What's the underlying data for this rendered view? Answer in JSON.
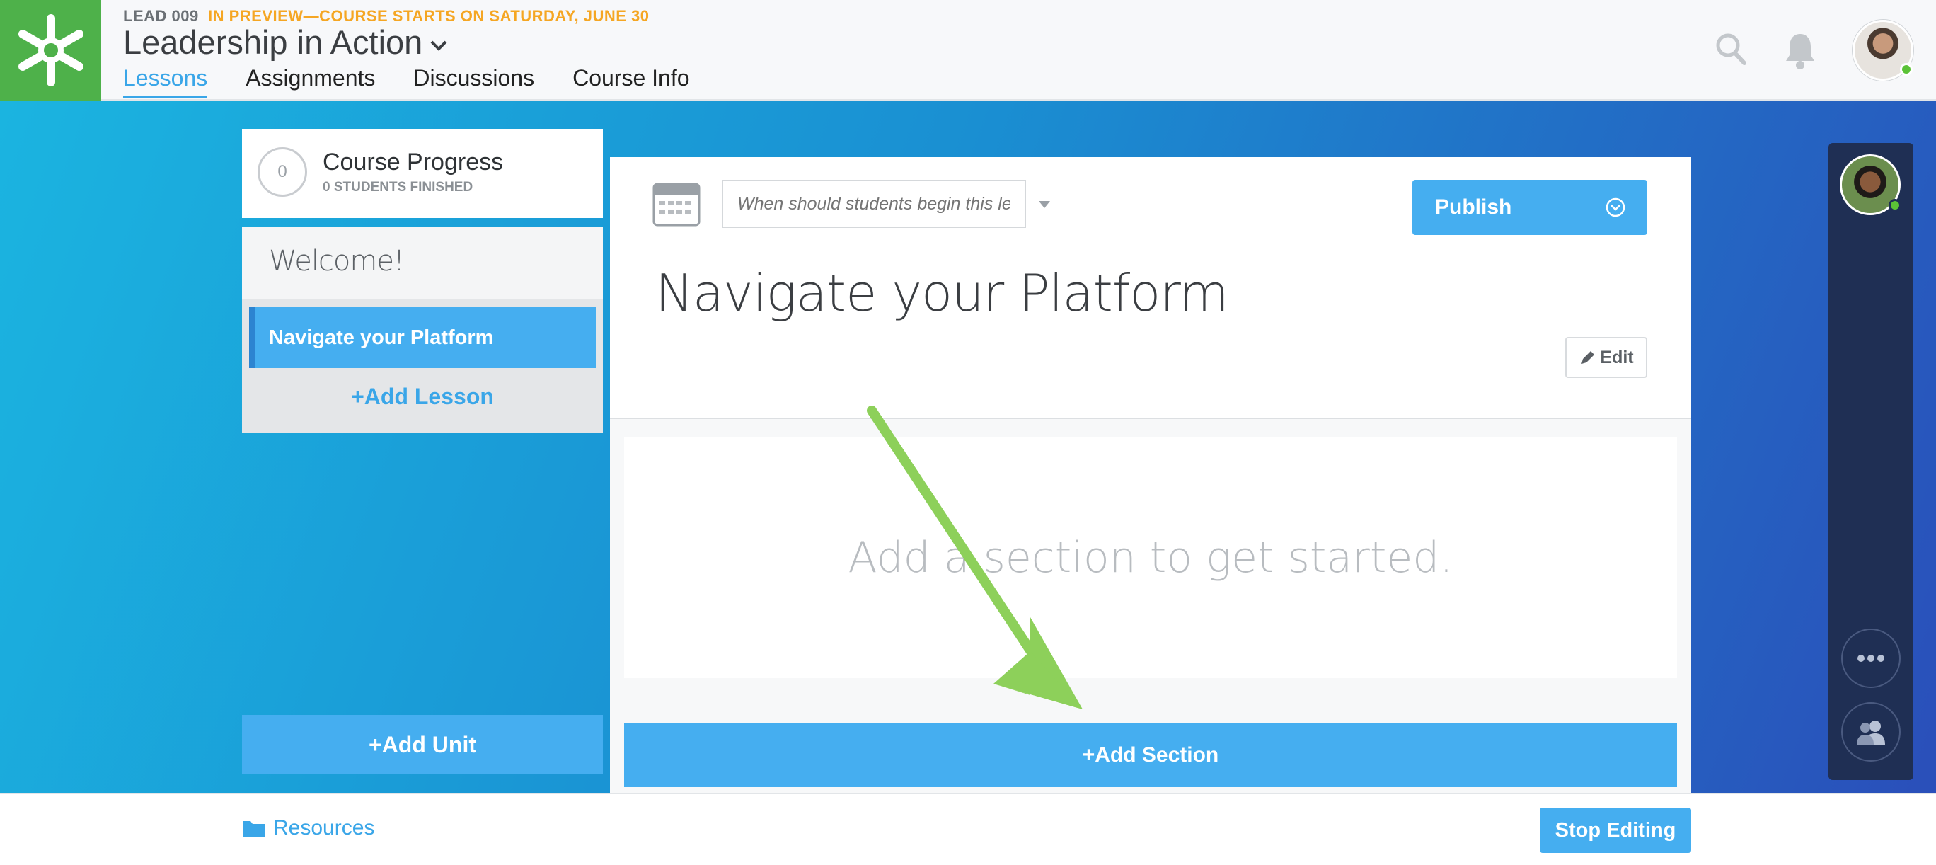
{
  "header": {
    "course_code": "LEAD 009",
    "preview_note": "IN PREVIEW—COURSE STARTS ON SATURDAY, JUNE 30",
    "course_title": "Leadership in Action",
    "tabs": [
      {
        "label": "Lessons",
        "active": true
      },
      {
        "label": "Assignments",
        "active": false
      },
      {
        "label": "Discussions",
        "active": false
      },
      {
        "label": "Course Info",
        "active": false
      }
    ],
    "icons": [
      "asterisk-logo-icon",
      "search-icon",
      "bell-icon",
      "user-avatar"
    ]
  },
  "sidebar": {
    "progress_count": "0",
    "progress_title": "Course Progress",
    "progress_sub": "0 STUDENTS FINISHED",
    "unit_title": "Welcome!",
    "lessons": [
      {
        "label": "Navigate your Platform",
        "selected": true
      }
    ],
    "add_lesson": "+Add Lesson",
    "add_unit": "+Add Unit"
  },
  "lesson": {
    "date_placeholder": "When should students begin this lesson?",
    "publish_label": "Publish",
    "title": "Navigate your Platform",
    "edit_label": "Edit",
    "empty_message": "Add a section to get started.",
    "add_section": "+Add Section"
  },
  "footer": {
    "resources_label": "Resources",
    "stop_editing_label": "Stop Editing"
  },
  "colors": {
    "brand_green": "#4eb14a",
    "accent_blue": "#45aef0",
    "link_blue": "#3aa6e8",
    "preview_orange": "#f5a623",
    "annotation_arrow": "#8dd05a",
    "rail_navy": "#1f2f54"
  }
}
